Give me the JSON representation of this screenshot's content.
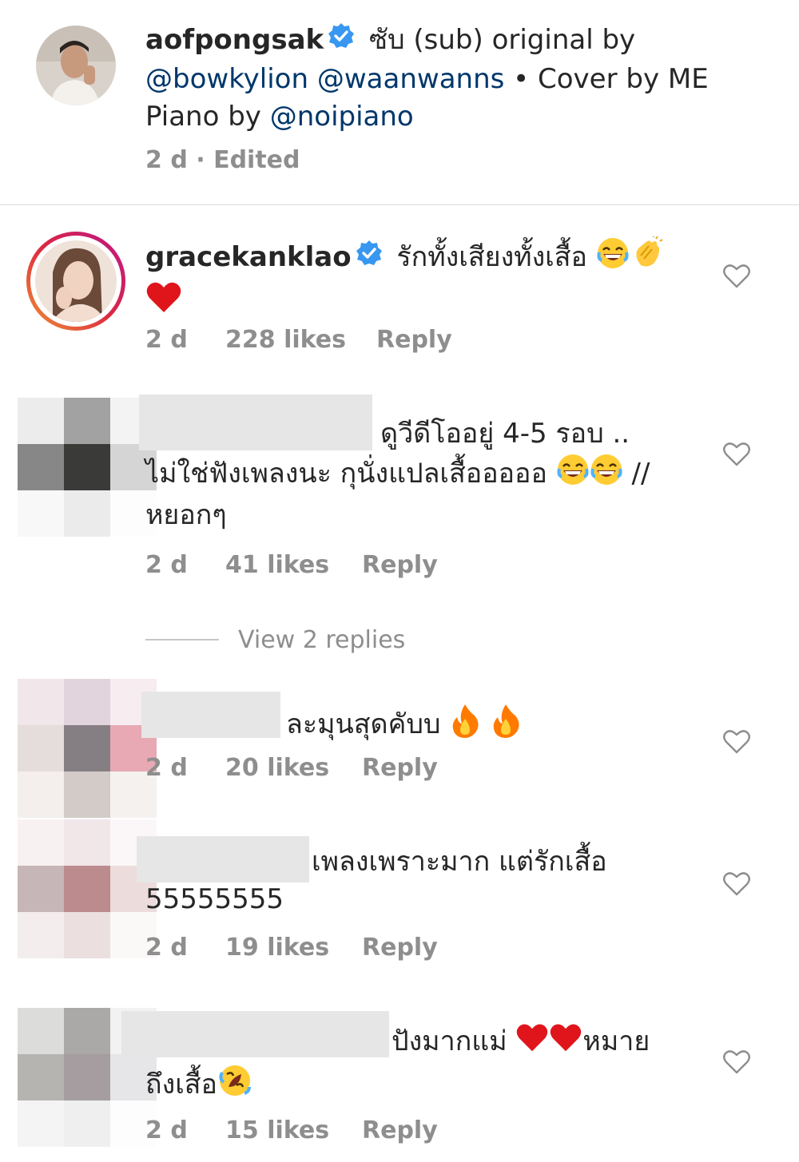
{
  "post": {
    "username": "aofpongsak",
    "caption_part1": "ซับ (sub) original by",
    "mention1": "@bowkylion",
    "mention2": "@waanwanns",
    "caption_part2": "• Cover by ME",
    "caption_part3": "Piano by",
    "mention3": "@noipiano",
    "meta": "2 d · Edited"
  },
  "comments": [
    {
      "username": "gracekanklao",
      "text": "รักทั้งเสียงทั้งเสื้อ",
      "time": "2 d",
      "likes": "228 likes",
      "reply": "Reply"
    },
    {
      "text_line1": "ดูวีดีโออยู่ 4-5 รอบ ..",
      "text_line2": "ไม่ใช่ฟังเพลงนะ กุนั่งแปลเสื้อออออ",
      "text_line2_suffix": "//",
      "text_line3": "หยอกๆ",
      "time": "2 d",
      "likes": "41 likes",
      "reply": "Reply"
    },
    {
      "text": "ละมุนสุดคับบ",
      "time": "2 d",
      "likes": "20 likes",
      "reply": "Reply"
    },
    {
      "text_line1": "เพลงเพราะมาก แต่รักเสื้อ",
      "text_line2": "55555555",
      "time": "2 d",
      "likes": "19 likes",
      "reply": "Reply"
    },
    {
      "text_line1": "ปังมากแม่",
      "text_line1_suffix": "หมาย",
      "text_line2": "ถึงเสื้อ",
      "time": "2 d",
      "likes": "15 likes",
      "reply": "Reply"
    }
  ],
  "view_replies": "View 2 replies",
  "colors": {
    "link": "#00376b",
    "meta": "#8e8e8e",
    "verified": "#3897f0"
  }
}
